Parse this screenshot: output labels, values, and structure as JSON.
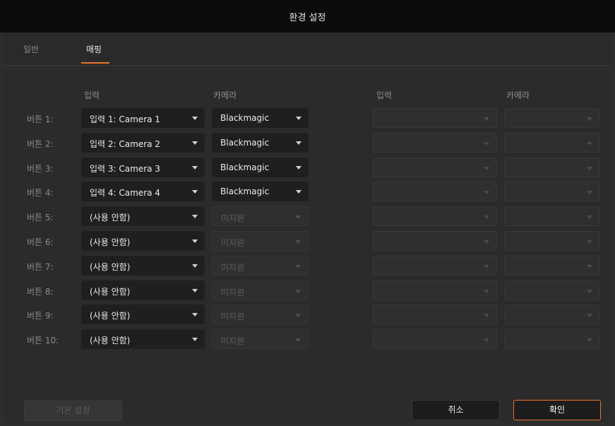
{
  "window": {
    "title": "환경 설정"
  },
  "tabs": [
    {
      "label": "일반"
    },
    {
      "label": "매핑"
    }
  ],
  "columns": {
    "left_input": "입력",
    "left_camera": "카메라",
    "right_input": "입력",
    "right_camera": "카메라"
  },
  "rows": [
    {
      "label": "버튼 1:",
      "input": "입력 1: Camera 1",
      "camera": "Blackmagic"
    },
    {
      "label": "버튼 2:",
      "input": "입력 2: Camera 2",
      "camera": "Blackmagic"
    },
    {
      "label": "버튼 3:",
      "input": "입력 3: Camera 3",
      "camera": "Blackmagic"
    },
    {
      "label": "버튼 4:",
      "input": "입력 4: Camera 4",
      "camera": "Blackmagic"
    },
    {
      "label": "버튼 5:",
      "input": "(사용 안함)",
      "camera": "미지원"
    },
    {
      "label": "버튼 6:",
      "input": "(사용 안함)",
      "camera": "미지원"
    },
    {
      "label": "버튼 7:",
      "input": "(사용 안함)",
      "camera": "미지원"
    },
    {
      "label": "버튼 8:",
      "input": "(사용 안함)",
      "camera": "미지원"
    },
    {
      "label": "버튼 9:",
      "input": "(사용 안함)",
      "camera": "미지원"
    },
    {
      "label": "버튼 10:",
      "input": "(사용 안함)",
      "camera": "미지원"
    }
  ],
  "buttons": {
    "defaults": "기본 설정",
    "cancel": "취소",
    "ok": "확인"
  },
  "colors": {
    "accent": "#e7752b",
    "titlebar": "#0c0c0c",
    "panel": "#2b2b2b"
  }
}
